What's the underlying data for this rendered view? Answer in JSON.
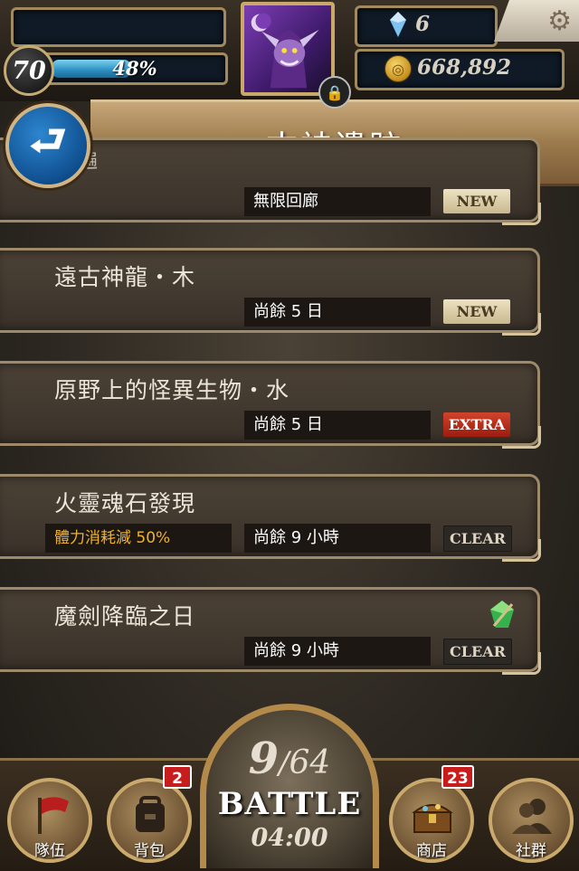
{
  "header": {
    "level": "70",
    "exp_percent_label": "48%",
    "exp_fraction": 0.48,
    "gems": "6",
    "gold": "668,892"
  },
  "banner": {
    "title": "古神遺跡",
    "partial_text": "遍"
  },
  "dungeons": [
    {
      "name": "",
      "time": "無限回廊",
      "tag": "NEW",
      "bonus": ""
    },
    {
      "name": "遠古神龍・木",
      "time": "尚餘 5 日",
      "tag": "NEW",
      "bonus": ""
    },
    {
      "name": "原野上的怪異生物・水",
      "time": "尚餘 5 日",
      "tag": "EXTRA",
      "bonus": ""
    },
    {
      "name": "火靈魂石發現",
      "time": "尚餘 9 小時",
      "tag": "CLEAR",
      "bonus": "體力消耗減 50%"
    },
    {
      "name": "魔劍降臨之日",
      "time": "尚餘 9 小時",
      "tag": "CLEAR",
      "bonus": ""
    }
  ],
  "colors": {
    "tag_new": "#e4d8b5",
    "tag_extra": "#c0321f",
    "tag_clear": "#2c2924",
    "bonus_text": "#f0b22c"
  },
  "nav": {
    "team": "隊伍",
    "bag": "背包",
    "bag_badge": "2",
    "shop": "商店",
    "shop_badge": "23",
    "social": "社群"
  },
  "battle": {
    "stamina_current": "9",
    "stamina_sep": "/",
    "stamina_max": "64",
    "label": "BATTLE",
    "timer": "04:00"
  },
  "icons": [
    "back-arrow-icon",
    "gem-icon",
    "coin-icon",
    "gear-icon",
    "lock-icon",
    "emerald-icon",
    "flag-icon",
    "backpack-icon",
    "treasure-chest-icon",
    "people-icon"
  ]
}
